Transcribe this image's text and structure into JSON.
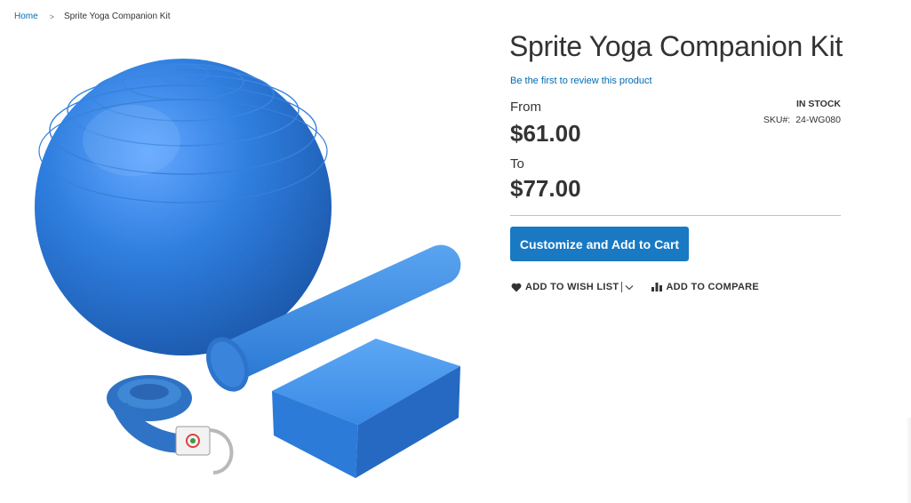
{
  "breadcrumb": {
    "home": "Home",
    "separator": ">",
    "current": "Sprite Yoga Companion Kit"
  },
  "product": {
    "title": "Sprite Yoga Companion Kit",
    "review_link": "Be the first to review this product",
    "stock_status": "IN STOCK",
    "sku_label": "SKU#:",
    "sku_value": "24-WG080",
    "price_from_label": "From",
    "price_from": "$61.00",
    "price_to_label": "To",
    "price_to": "$77.00",
    "add_to_cart_label": "Customize and Add to Cart",
    "wishlist_label": "ADD TO WISH LIST",
    "compare_label": "ADD TO COMPARE",
    "gallery_image": "product-photo: blue yoga ball, foam roller, yoga block, yoga strap"
  },
  "colors": {
    "link": "#006bb4",
    "primary_button": "#1979c3",
    "text": "#333333",
    "product_blue": "#2f7fd6"
  },
  "icons": {
    "breadcrumb_separator": "chevron-right-icon",
    "wishlist": "heart-icon",
    "wishlist_toggle": "chevron-down-icon",
    "compare": "bar-chart-icon"
  }
}
